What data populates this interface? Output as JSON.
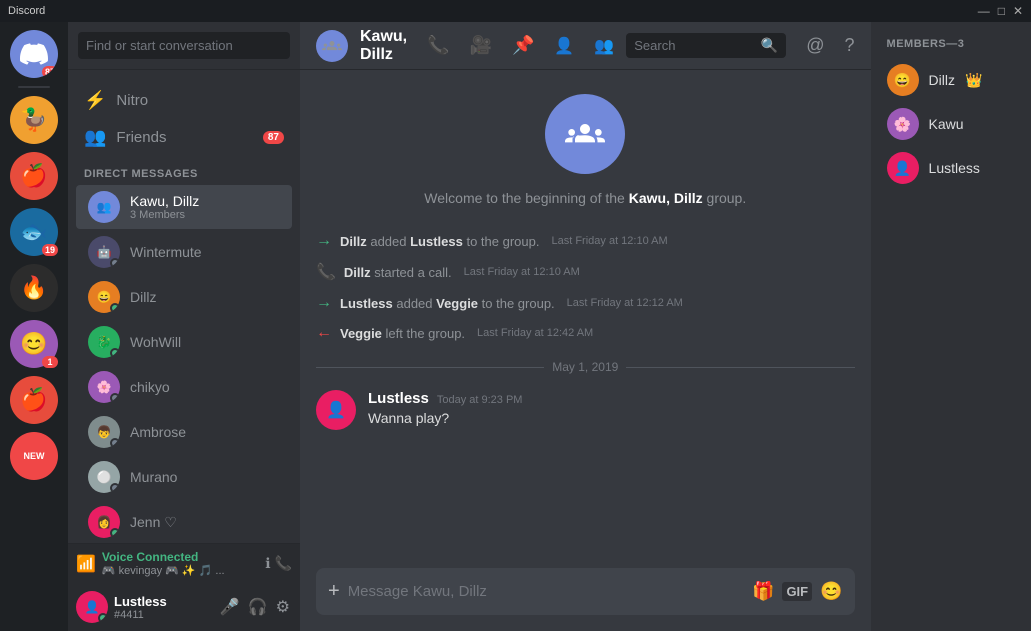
{
  "titlebar": {
    "title": "Discord",
    "minimize": "—",
    "maximize": "□",
    "close": "✕"
  },
  "server_sidebar": {
    "discord_badge": "87",
    "servers": [
      {
        "id": "s1",
        "emoji": "🦆",
        "bg": "#f0a030"
      },
      {
        "id": "s2",
        "emoji": "🍎",
        "bg": "#e74c3c"
      },
      {
        "id": "s3",
        "emoji": "🐟",
        "bg": "#3498db"
      },
      {
        "id": "s4",
        "emoji": "🔥",
        "bg": "#e74c3c"
      },
      {
        "id": "s5",
        "emoji": "😊",
        "bg": "#9b59b6"
      },
      {
        "id": "s6",
        "emoji": "🍎",
        "bg": "#e74c3c",
        "badge": "1"
      },
      {
        "id": "s7",
        "emoji": "19",
        "bg": "#3498db",
        "badge": "19"
      },
      {
        "id": "new",
        "label": "NEW",
        "bg": "#f04747"
      }
    ]
  },
  "dm_sidebar": {
    "search_placeholder": "Find or start conversation",
    "nitro_label": "Nitro",
    "friends_label": "Friends",
    "friends_badge": "87",
    "section_label": "DIRECT MESSAGES",
    "dm_list": [
      {
        "id": "kawu-dillz",
        "name": "Kawu, Dillz",
        "sub": "3 Members",
        "active": true,
        "avatar_text": "👥",
        "avatar_bg": "#7289da"
      },
      {
        "id": "wintermute",
        "name": "Wintermute",
        "sub": "",
        "active": false,
        "avatar_text": "🤖",
        "avatar_bg": "#4a4a6a",
        "status": "offline"
      },
      {
        "id": "dillz",
        "name": "Dillz",
        "sub": "",
        "active": false,
        "avatar_text": "😄",
        "avatar_bg": "#e67e22",
        "status": "online"
      },
      {
        "id": "wohwill",
        "name": "WohWill",
        "sub": "",
        "active": false,
        "avatar_text": "🐉",
        "avatar_bg": "#27ae60",
        "status": "online"
      },
      {
        "id": "chikyo",
        "name": "chikyo",
        "sub": "",
        "active": false,
        "avatar_text": "🌸",
        "avatar_bg": "#9b59b6",
        "status": "offline"
      },
      {
        "id": "ambrose",
        "name": "Ambrose",
        "sub": "",
        "active": false,
        "avatar_text": "👦",
        "avatar_bg": "#7f8c8d",
        "status": "offline"
      },
      {
        "id": "murano",
        "name": "Murano",
        "sub": "",
        "active": false,
        "avatar_text": "⚪",
        "avatar_bg": "#95a5a6",
        "status": "offline"
      },
      {
        "id": "jenn",
        "name": "Jenn ♡",
        "sub": "",
        "active": false,
        "avatar_text": "👩",
        "avatar_bg": "#e91e63",
        "status": "online"
      }
    ],
    "voice_connected": {
      "title": "Voice Connected",
      "subtitle": "🎮 kevingay 🎮 ✨ 🎵 ..."
    },
    "user": {
      "name": "Lustless",
      "tag": "#4411",
      "avatar": "👤",
      "avatar_bg": "#e91e63"
    }
  },
  "chat": {
    "title": "Kawu, Dillz",
    "welcome_text": "Welcome to the beginning of the",
    "group_name": "Kawu, Dillz",
    "welcome_suffix": "group.",
    "messages": [
      {
        "type": "system",
        "icon": "→",
        "icon_type": "arrow",
        "text_parts": [
          "Dillz",
          " added ",
          "Lustless",
          " to the group."
        ],
        "bold": [
          0,
          2
        ],
        "timestamp": "Last Friday at 12:10 AM"
      },
      {
        "type": "system",
        "icon": "📞",
        "icon_type": "phone",
        "text_parts": [
          "Dillz",
          " started a call."
        ],
        "bold": [
          0
        ],
        "timestamp": "Last Friday at 12:10 AM"
      },
      {
        "type": "system",
        "icon": "→",
        "icon_type": "arrow",
        "text_parts": [
          "Lustless",
          " added ",
          "Veggie",
          " to the group."
        ],
        "bold": [
          0,
          2
        ],
        "timestamp": "Last Friday at 12:12 AM"
      },
      {
        "type": "system",
        "icon": "←",
        "icon_type": "arrow-left",
        "text_parts": [
          "Veggie",
          " left the group."
        ],
        "bold": [
          0
        ],
        "timestamp": "Last Friday at 12:42 AM"
      }
    ],
    "date_divider": "May 1, 2019",
    "user_message": {
      "author": "Lustless",
      "timestamp": "Today at 9:23 PM",
      "text": "Wanna play?",
      "avatar_bg": "#e91e63",
      "avatar_text": "👤"
    },
    "input_placeholder": "Message Kawu, Dillz"
  },
  "members": {
    "label": "MEMBERS—3",
    "list": [
      {
        "name": "Dillz",
        "badge": "👑",
        "avatar_bg": "#e67e22",
        "avatar_text": "😄",
        "status": "online"
      },
      {
        "name": "Kawu",
        "badge": "",
        "avatar_bg": "#9b59b6",
        "avatar_text": "🌸",
        "status": "online"
      },
      {
        "name": "Lustless",
        "badge": "",
        "avatar_bg": "#e91e63",
        "avatar_text": "👤",
        "status": "online"
      }
    ]
  },
  "header_icons": {
    "phone": "📞",
    "video": "🎥",
    "pin": "📌",
    "add_friend": "👤+",
    "members": "👥",
    "search": "Search",
    "at": "@",
    "help": "?"
  }
}
